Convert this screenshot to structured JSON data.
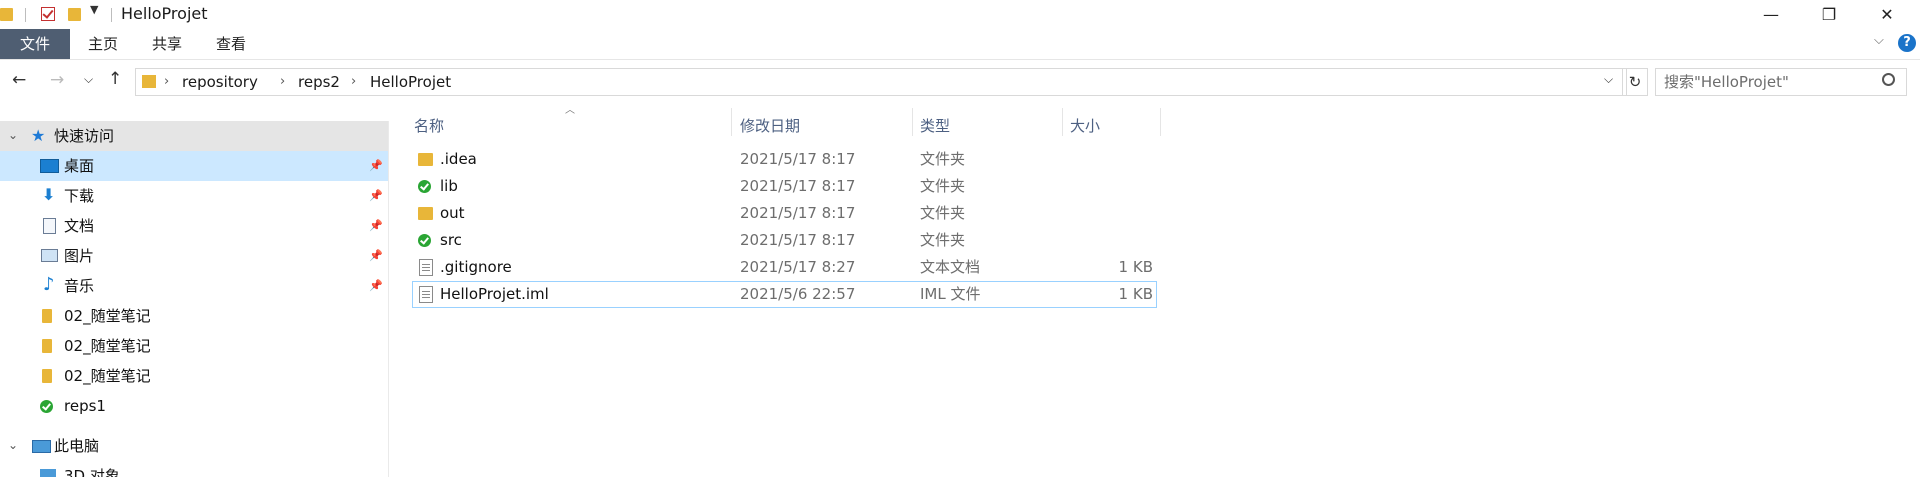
{
  "window": {
    "title": "HelloProjet",
    "controls": {
      "minimize": "—",
      "restore": "❐",
      "close": "✕"
    }
  },
  "ribbon": {
    "tabs": [
      "文件",
      "主页",
      "共享",
      "查看"
    ],
    "help_label": "?"
  },
  "address": {
    "breadcrumbs": [
      "repository",
      "reps2",
      "HelloProjet"
    ],
    "search_placeholder": "搜索\"HelloProjet\""
  },
  "nav": {
    "quick_access": "快速访问",
    "items": [
      {
        "label": "桌面",
        "icon": "desktop-icon",
        "pinned": true
      },
      {
        "label": "下载",
        "icon": "download-icon",
        "pinned": true
      },
      {
        "label": "文档",
        "icon": "document-icon",
        "pinned": true
      },
      {
        "label": "图片",
        "icon": "picture-icon",
        "pinned": true
      },
      {
        "label": "音乐",
        "icon": "music-icon",
        "pinned": true
      },
      {
        "label": "02_随堂笔记",
        "icon": "folder-icon",
        "pinned": false
      },
      {
        "label": "02_随堂笔记",
        "icon": "folder-icon",
        "pinned": false
      },
      {
        "label": "02_随堂笔记",
        "icon": "folder-icon",
        "pinned": false
      },
      {
        "label": "reps1",
        "icon": "git-folder-icon",
        "pinned": false
      }
    ],
    "this_pc": "此电脑",
    "partial_item": "3D 对象"
  },
  "files": {
    "columns": [
      "名称",
      "修改日期",
      "类型",
      "大小"
    ],
    "rows": [
      {
        "name": ".idea",
        "date": "2021/5/17 8:17",
        "type": "文件夹",
        "size": "",
        "icon": "folder-icon"
      },
      {
        "name": "lib",
        "date": "2021/5/17 8:17",
        "type": "文件夹",
        "size": "",
        "icon": "git-folder-icon"
      },
      {
        "name": "out",
        "date": "2021/5/17 8:17",
        "type": "文件夹",
        "size": "",
        "icon": "folder-icon"
      },
      {
        "name": "src",
        "date": "2021/5/17 8:17",
        "type": "文件夹",
        "size": "",
        "icon": "git-folder-icon"
      },
      {
        "name": ".gitignore",
        "date": "2021/5/17 8:27",
        "type": "文本文档",
        "size": "1 KB",
        "icon": "text-file-icon"
      },
      {
        "name": "HelloProjet.iml",
        "date": "2021/5/6 22:57",
        "type": "IML 文件",
        "size": "1 KB",
        "icon": "file-icon"
      }
    ]
  },
  "colors": {
    "accent": "#4f5e72",
    "selection": "#cce8ff",
    "folder": "#e8b639",
    "git": "#2aa534",
    "header_text": "#4d6082"
  }
}
